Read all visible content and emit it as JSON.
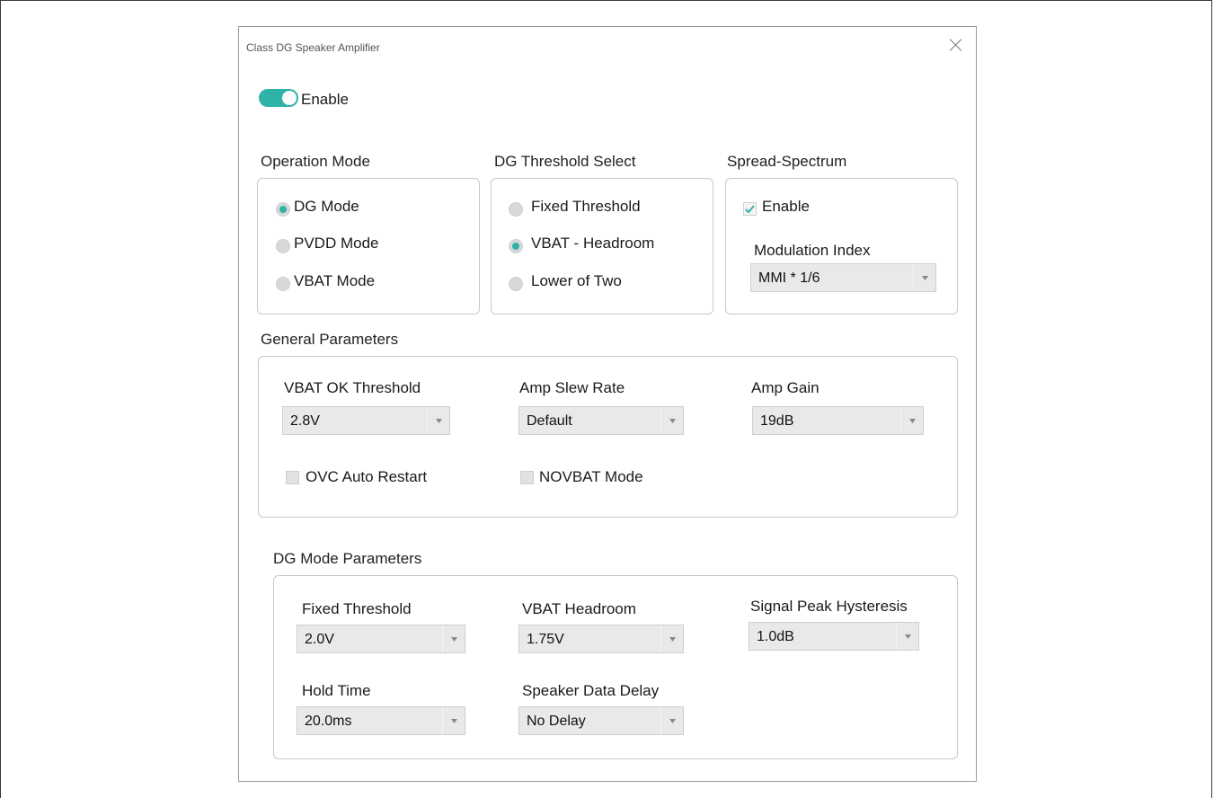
{
  "window": {
    "title": "Class DG Speaker Amplifier"
  },
  "enable": {
    "label": "Enable",
    "on": true
  },
  "operation_mode": {
    "heading": "Operation Mode",
    "options": [
      "DG Mode",
      "PVDD Mode",
      "VBAT Mode"
    ],
    "selected": "DG Mode"
  },
  "dg_threshold": {
    "heading": "DG Threshold Select",
    "options": [
      "Fixed Threshold",
      "VBAT - Headroom",
      "Lower of Two"
    ],
    "selected": "VBAT - Headroom"
  },
  "spread_spectrum": {
    "heading": "Spread-Spectrum",
    "enable_label": "Enable",
    "enable_checked": true,
    "modulation_label": "Modulation Index",
    "modulation_value": "MMI * 1/6"
  },
  "general": {
    "heading": "General Parameters",
    "vbat_ok": {
      "label": "VBAT OK Threshold",
      "value": "2.8V"
    },
    "slew": {
      "label": "Amp Slew Rate",
      "value": "Default"
    },
    "gain": {
      "label": "Amp Gain",
      "value": "19dB"
    },
    "ovc": {
      "label": "OVC Auto Restart",
      "checked": false
    },
    "novbat": {
      "label": "NOVBAT Mode",
      "checked": false
    }
  },
  "dg_params": {
    "heading": "DG Mode Parameters",
    "fixed_threshold": {
      "label": "Fixed Threshold",
      "value": "2.0V"
    },
    "vbat_headroom": {
      "label": "VBAT Headroom",
      "value": "1.75V"
    },
    "hysteresis": {
      "label": "Signal Peak Hysteresis",
      "value": "1.0dB"
    },
    "hold_time": {
      "label": "Hold Time",
      "value": "20.0ms"
    },
    "data_delay": {
      "label": "Speaker Data Delay",
      "value": "No Delay"
    }
  },
  "colors": {
    "accent": "#2fb3a8",
    "border": "#c9c9c9",
    "select_bg": "#e9e9e9"
  }
}
